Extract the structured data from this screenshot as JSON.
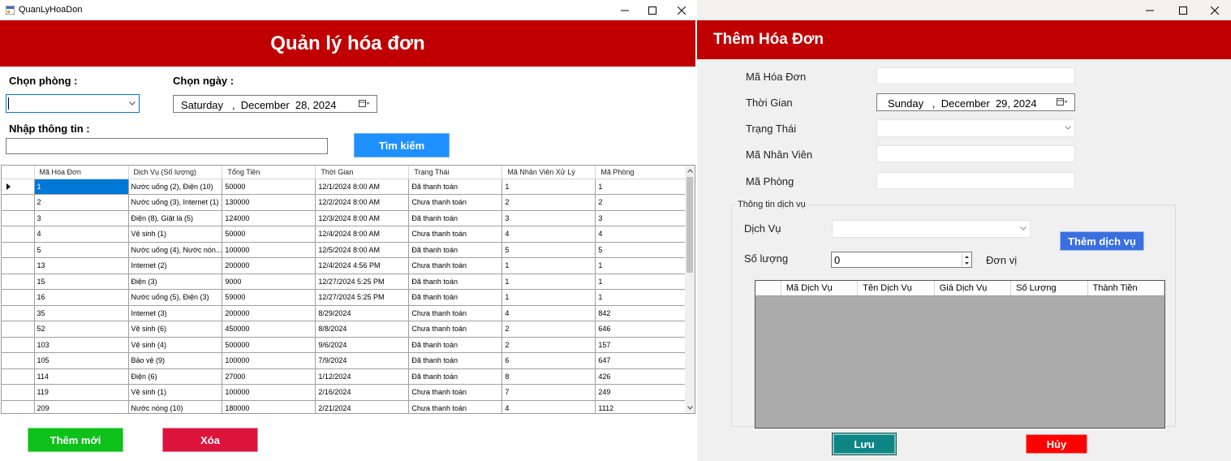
{
  "window1": {
    "title": "QuanLyHoaDon",
    "banner": "Quản lý hóa đơn",
    "room_label": "Chọn phòng :",
    "room_value": "",
    "date_label": "Chọn ngày :",
    "date_value": "Saturday   ,  December  28, 2024",
    "info_label": "Nhập thông tin :",
    "info_value": "",
    "search_button": "Tìm kiếm",
    "add_button": "Thêm mới",
    "delete_button": "Xóa",
    "columns": [
      "Mã Hóa Đơn",
      "Dịch Vụ (Số lượng)",
      "Tổng Tiền",
      "Thời Gian",
      "Trạng Thái",
      "Mã Nhân Viên Xử Lý",
      "Mã Phòng"
    ],
    "rows": [
      [
        "1",
        "Nước uống (2), Điện (10)",
        "50000",
        "12/1/2024 8:00 AM",
        "Đã thanh toán",
        "1",
        "1"
      ],
      [
        "2",
        "Nước uống (3), Internet (1)",
        "130000",
        "12/2/2024 8:00 AM",
        "Chưa thanh toán",
        "2",
        "2"
      ],
      [
        "3",
        "Điện (8), Giặt là (5)",
        "124000",
        "12/3/2024 8:00 AM",
        "Đã thanh toán",
        "3",
        "3"
      ],
      [
        "4",
        "Vệ sinh (1)",
        "50000",
        "12/4/2024 8:00 AM",
        "Chưa thanh toán",
        "4",
        "4"
      ],
      [
        "5",
        "Nước uống (4), Nước nón...",
        "100000",
        "12/5/2024 8:00 AM",
        "Đã thanh toán",
        "5",
        "5"
      ],
      [
        "13",
        "Internet (2)",
        "200000",
        "12/4/2024 4:56 PM",
        "Chưa thanh toán",
        "1",
        "1"
      ],
      [
        "15",
        "Điện (3)",
        "9000",
        "12/27/2024 5:25 PM",
        "Đã thanh toán",
        "1",
        "1"
      ],
      [
        "16",
        "Nước uống (5), Điện (3)",
        "59000",
        "12/27/2024 5:25 PM",
        "Đã thanh toán",
        "1",
        "1"
      ],
      [
        "35",
        "Internet (3)",
        "200000",
        "8/29/2024",
        "Chưa thanh toán",
        "4",
        "842"
      ],
      [
        "52",
        "Vệ sinh (6)",
        "450000",
        "8/8/2024",
        "Chưa thanh toán",
        "2",
        "646"
      ],
      [
        "103",
        "Vệ sinh (4)",
        "500000",
        "9/6/2024",
        "Đã thanh toán",
        "2",
        "157"
      ],
      [
        "105",
        "Bảo vệ (9)",
        "100000",
        "7/9/2024",
        "Đã thanh toán",
        "6",
        "647"
      ],
      [
        "114",
        "Điện (6)",
        "27000",
        "1/12/2024",
        "Đã thanh toán",
        "8",
        "426"
      ],
      [
        "119",
        "Vệ sinh (1)",
        "100000",
        "2/16/2024",
        "Chưa thanh toán",
        "7",
        "249"
      ],
      [
        "209",
        "Nước nóng (10)",
        "180000",
        "2/21/2024",
        "Chưa thanh toán",
        "4",
        "1112"
      ]
    ]
  },
  "window2": {
    "banner": "Thêm Hóa Đơn",
    "fields": {
      "invoice_id_label": "Mã Hóa Đơn",
      "invoice_id_value": "",
      "time_label": "Thời Gian",
      "time_value": "Sunday   ,  December  29, 2024",
      "status_label": "Trạng Thái",
      "status_value": "",
      "employee_label": "Mã Nhân Viên",
      "employee_value": "",
      "room_label": "Mã Phòng",
      "room_value": ""
    },
    "group_title": "Thông tin dịch vụ",
    "service_label": "Dịch Vụ",
    "service_value": "",
    "quantity_label": "Số lượng",
    "quantity_value": "0",
    "unit_label": "Đơn vị",
    "add_service_button": "Thêm dịch vụ",
    "service_columns": [
      "Mã Dịch Vụ",
      "Tên Dịch Vụ",
      "Giá Dịch Vụ",
      "Số Lượng",
      "Thành Tiền"
    ],
    "save_button": "Lưu",
    "cancel_button": "Hủy"
  },
  "colors": {
    "banner": "#c00000",
    "search_button": "#1e90ff",
    "add_button": "#0ec01a",
    "delete_button": "#dc143c",
    "add_service_button": "#3a6fe0",
    "save_button": "#0d8585",
    "cancel_button": "#ff0000",
    "selection": "#0078d7"
  }
}
